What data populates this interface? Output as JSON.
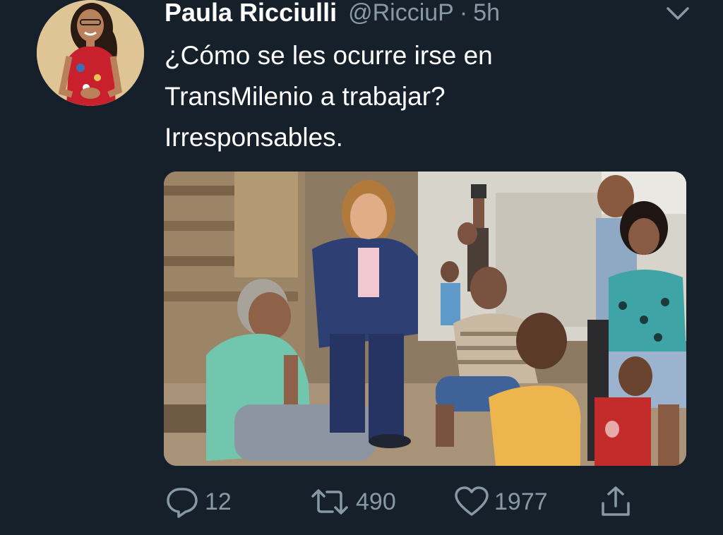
{
  "tweet": {
    "author_name": "Paula Ricciulli",
    "handle": "@RicciuP",
    "separator": "·",
    "time": "5h",
    "text_lines": [
      "¿Cómo se les ocurre irse en",
      "TransMilenio a trabajar?",
      "Irresponsables."
    ]
  },
  "actions": {
    "replies": "12",
    "retweets": "490",
    "likes": "1977"
  },
  "icons": {
    "reply": "reply-icon",
    "retweet": "retweet-icon",
    "like": "heart-icon",
    "share": "share-icon",
    "menu": "chevron-down-icon"
  },
  "colors": {
    "background": "#15202b",
    "primary_text": "#ffffff",
    "secondary_text": "#8899a6"
  }
}
